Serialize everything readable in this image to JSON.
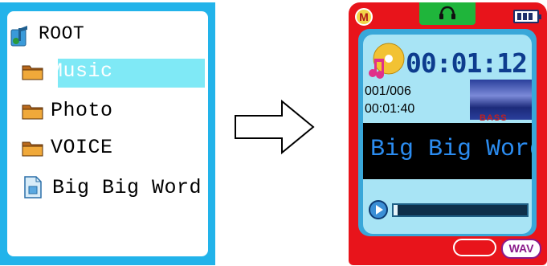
{
  "browser": {
    "items": [
      {
        "label": "ROOT",
        "icon": "music-note-icon"
      },
      {
        "label": "Music",
        "icon": "folder-icon",
        "selected": true
      },
      {
        "label": "Photo",
        "icon": "folder-icon"
      },
      {
        "label": "VOICE",
        "icon": "folder-icon"
      },
      {
        "label": "Big Big Word",
        "icon": "audio-file-icon"
      }
    ],
    "colors": {
      "frame": "#22b3ea",
      "selection": "#7fe9f6"
    }
  },
  "arrow": {
    "icon": "right-arrow-icon"
  },
  "player": {
    "badge": "M",
    "time_total": "00:01:12",
    "track_number": "001/006",
    "time_elapsed": "00:01:40",
    "eq_label": "BASS",
    "song_title": "Big Big Word",
    "format_label": "WAV",
    "progress": 0.03,
    "colors": {
      "body": "#e8141b",
      "screen": "#a8e4f5",
      "title_text": "#2b8cf0",
      "clock": "#0e3c8e"
    }
  }
}
